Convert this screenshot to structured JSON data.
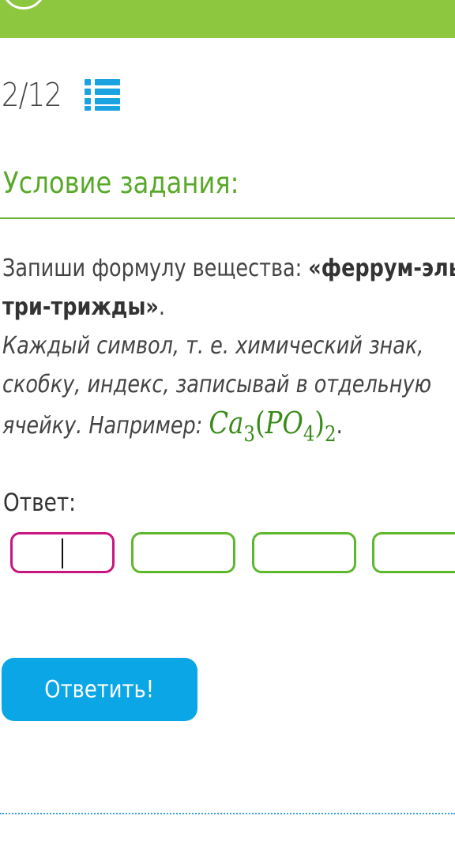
{
  "header": {
    "bar_color": "#8dc63f",
    "icon": "circle-icon"
  },
  "progress": {
    "label": "2/12",
    "list_icon": "list-icon",
    "list_icon_color": "#1aa3e0"
  },
  "section": {
    "title": "Условие задания:",
    "title_color": "#5aa82a"
  },
  "task": {
    "line1_plain": "Запиши формулу вещества: ",
    "line1_bold": "«феррум-эль",
    "line2_bold": "три-трижды»",
    "line2_tail": ".",
    "line3": "Каждый символ, т. е. химический знак,",
    "line4": "скобку, индекс, записывай в отдельную",
    "line5_lead": "ячейку. Например: ",
    "example": {
      "ca": "Ca",
      "ca_sub": "3",
      "open": "(",
      "po": "PO",
      "po_sub": "4",
      "close": ")",
      "group_sub": "2"
    },
    "line5_tail": "."
  },
  "answer": {
    "label": "Ответ:",
    "cells": [
      "",
      "",
      "",
      ""
    ],
    "active_border_color": "#c8157f",
    "border_color": "#5cb82d"
  },
  "submit": {
    "label": "Ответить!",
    "color": "#0aa6e6"
  }
}
